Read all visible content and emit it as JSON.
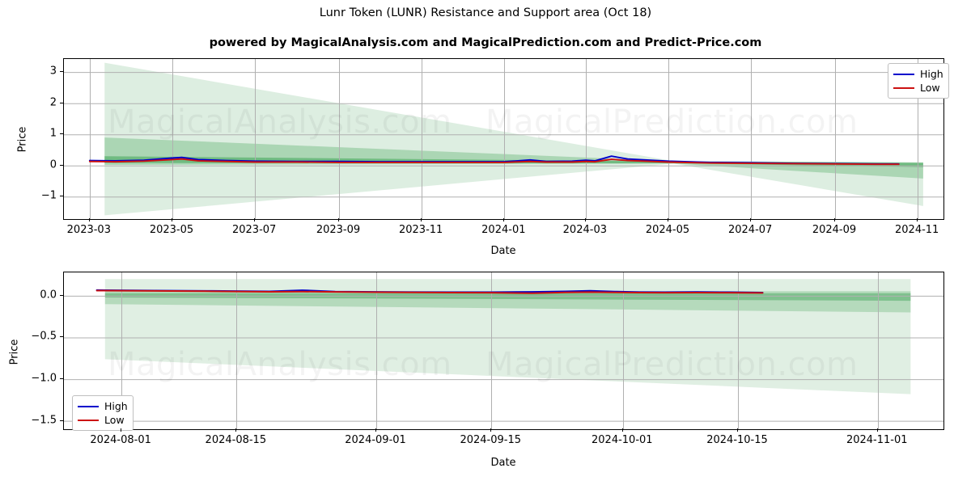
{
  "figure": {
    "title": "Lunr Token (LUNR) Resistance and Support area (Oct 18)",
    "subtitle": "powered by MagicalAnalysis.com and MagicalPrediction.com and Predict-Price.com",
    "watermarks": [
      "MagicalAnalysis.com",
      "MagicalPrediction.com",
      "MagicalAnalysis.com",
      "MagicalPrediction.com"
    ],
    "colors": {
      "high_line": "#0000cc",
      "low_line": "#cc1111",
      "band_outer": "#8fc79a",
      "band_mid": "#6fb97f",
      "band_inner": "#4aa85f",
      "grid": "#b0b0b0",
      "axis": "#000000"
    }
  },
  "chart_data": [
    {
      "id": "upper",
      "type": "line",
      "title": "Lunr Token (LUNR) Resistance and Support area (Oct 18)",
      "xlabel": "Date",
      "ylabel": "Price",
      "grid": true,
      "legend_position": "upper right",
      "xticks": [
        "2023-03",
        "2023-05",
        "2023-07",
        "2023-09",
        "2023-11",
        "2024-01",
        "2024-03",
        "2024-05",
        "2024-07",
        "2024-09",
        "2024-11"
      ],
      "yticks": [
        3,
        2,
        1,
        0,
        -1
      ],
      "ylim": [
        -1.72,
        3.42
      ],
      "xlim": [
        "2023-02-10",
        "2024-11-20"
      ],
      "series": [
        {
          "name": "High",
          "color": "#0000cc",
          "x": [
            "2023-03-01",
            "2023-03-20",
            "2023-04-10",
            "2023-05-01",
            "2023-05-08",
            "2023-05-20",
            "2023-06-10",
            "2023-07-01",
            "2023-08-01",
            "2023-09-01",
            "2023-10-01",
            "2023-11-01",
            "2023-12-01",
            "2024-01-01",
            "2024-01-20",
            "2024-02-01",
            "2024-02-20",
            "2024-03-01",
            "2024-03-08",
            "2024-03-20",
            "2024-04-01",
            "2024-05-01",
            "2024-06-01",
            "2024-07-01",
            "2024-08-01",
            "2024-09-01",
            "2024-10-01",
            "2024-10-18"
          ],
          "y": [
            0.16,
            0.15,
            0.17,
            0.24,
            0.26,
            0.19,
            0.16,
            0.14,
            0.13,
            0.13,
            0.12,
            0.12,
            0.12,
            0.12,
            0.18,
            0.13,
            0.14,
            0.17,
            0.15,
            0.3,
            0.21,
            0.14,
            0.1,
            0.09,
            0.07,
            0.06,
            0.05,
            0.05
          ]
        },
        {
          "name": "Low",
          "color": "#cc1111",
          "x": [
            "2023-03-01",
            "2023-03-20",
            "2023-04-10",
            "2023-05-01",
            "2023-05-08",
            "2023-05-20",
            "2023-06-10",
            "2023-07-01",
            "2023-08-01",
            "2023-09-01",
            "2023-10-01",
            "2023-11-01",
            "2023-12-01",
            "2024-01-01",
            "2024-01-20",
            "2024-02-01",
            "2024-02-20",
            "2024-03-01",
            "2024-03-08",
            "2024-03-20",
            "2024-04-01",
            "2024-05-01",
            "2024-06-01",
            "2024-07-01",
            "2024-08-01",
            "2024-09-01",
            "2024-10-01",
            "2024-10-18"
          ],
          "y": [
            0.13,
            0.12,
            0.14,
            0.19,
            0.21,
            0.15,
            0.13,
            0.11,
            0.11,
            0.1,
            0.1,
            0.1,
            0.1,
            0.1,
            0.13,
            0.11,
            0.11,
            0.13,
            0.12,
            0.2,
            0.16,
            0.11,
            0.08,
            0.07,
            0.06,
            0.05,
            0.04,
            0.04
          ]
        }
      ],
      "bands": [
        {
          "name": "outer",
          "color": "#8fc79a",
          "opacity": 0.3,
          "x": [
            "2023-03-12",
            "2024-05-05",
            "2024-11-05"
          ],
          "upper": [
            3.3,
            0.14,
            0.1
          ],
          "lower": [
            -1.6,
            0.06,
            -1.3
          ]
        },
        {
          "name": "mid",
          "color": "#6fb97f",
          "opacity": 0.45,
          "x": [
            "2023-03-12",
            "2024-05-05",
            "2024-11-05"
          ],
          "upper": [
            0.9,
            0.14,
            0.1
          ],
          "lower": [
            0.02,
            0.06,
            -0.42
          ]
        },
        {
          "name": "inner",
          "color": "#4aa85f",
          "opacity": 0.6,
          "x": [
            "2023-03-12",
            "2024-05-05",
            "2024-11-05"
          ],
          "upper": [
            0.3,
            0.13,
            0.08
          ],
          "lower": [
            0.08,
            0.07,
            -0.05
          ]
        }
      ]
    },
    {
      "id": "lower",
      "type": "line",
      "xlabel": "Date",
      "ylabel": "Price",
      "grid": true,
      "legend_position": "lower left",
      "xticks": [
        "2024-08-01",
        "2024-08-15",
        "2024-09-01",
        "2024-09-15",
        "2024-10-01",
        "2024-10-15",
        "2024-11-01"
      ],
      "yticks": [
        "0.0",
        "−0.5",
        "−1.0",
        "−1.5"
      ],
      "ylim": [
        -1.6,
        0.28
      ],
      "xlim": [
        "2024-07-25",
        "2024-11-09"
      ],
      "series": [
        {
          "name": "High",
          "color": "#0000cc",
          "x": [
            "2024-07-29",
            "2024-08-05",
            "2024-08-12",
            "2024-08-19",
            "2024-08-23",
            "2024-08-27",
            "2024-09-01",
            "2024-09-05",
            "2024-09-10",
            "2024-09-15",
            "2024-09-20",
            "2024-09-24",
            "2024-09-27",
            "2024-09-30",
            "2024-10-03",
            "2024-10-06",
            "2024-10-10",
            "2024-10-14",
            "2024-10-18"
          ],
          "y": [
            0.068,
            0.062,
            0.058,
            0.052,
            0.066,
            0.05,
            0.046,
            0.044,
            0.043,
            0.043,
            0.046,
            0.052,
            0.06,
            0.05,
            0.044,
            0.042,
            0.045,
            0.042,
            0.038
          ]
        },
        {
          "name": "Low",
          "color": "#cc1111",
          "x": [
            "2024-07-29",
            "2024-08-05",
            "2024-08-12",
            "2024-08-19",
            "2024-08-23",
            "2024-08-27",
            "2024-09-01",
            "2024-09-05",
            "2024-09-10",
            "2024-09-15",
            "2024-09-20",
            "2024-09-24",
            "2024-09-27",
            "2024-09-30",
            "2024-10-03",
            "2024-10-06",
            "2024-10-10",
            "2024-10-14",
            "2024-10-18"
          ],
          "y": [
            0.062,
            0.058,
            0.054,
            0.048,
            0.05,
            0.046,
            0.042,
            0.04,
            0.038,
            0.036,
            0.03,
            0.04,
            0.044,
            0.04,
            0.038,
            0.036,
            0.038,
            0.036,
            0.034
          ]
        }
      ],
      "bands": [
        {
          "name": "outer",
          "color": "#8fc79a",
          "opacity": 0.28,
          "x": [
            "2024-07-30",
            "2024-11-05"
          ],
          "upper": [
            0.2,
            0.2
          ],
          "lower": [
            -0.76,
            -1.18
          ]
        },
        {
          "name": "mid",
          "color": "#6fb97f",
          "opacity": 0.38,
          "x": [
            "2024-07-30",
            "2024-11-05"
          ],
          "upper": [
            0.055,
            0.055
          ],
          "lower": [
            -0.1,
            -0.2
          ]
        },
        {
          "name": "inner",
          "color": "#4aa85f",
          "opacity": 0.5,
          "x": [
            "2024-07-30",
            "2024-11-05"
          ],
          "upper": [
            0.03,
            0.03
          ],
          "lower": [
            -0.02,
            -0.06
          ]
        }
      ]
    }
  ],
  "legend": {
    "items": [
      {
        "label": "High",
        "color": "#0000cc"
      },
      {
        "label": "Low",
        "color": "#cc1111"
      }
    ]
  }
}
